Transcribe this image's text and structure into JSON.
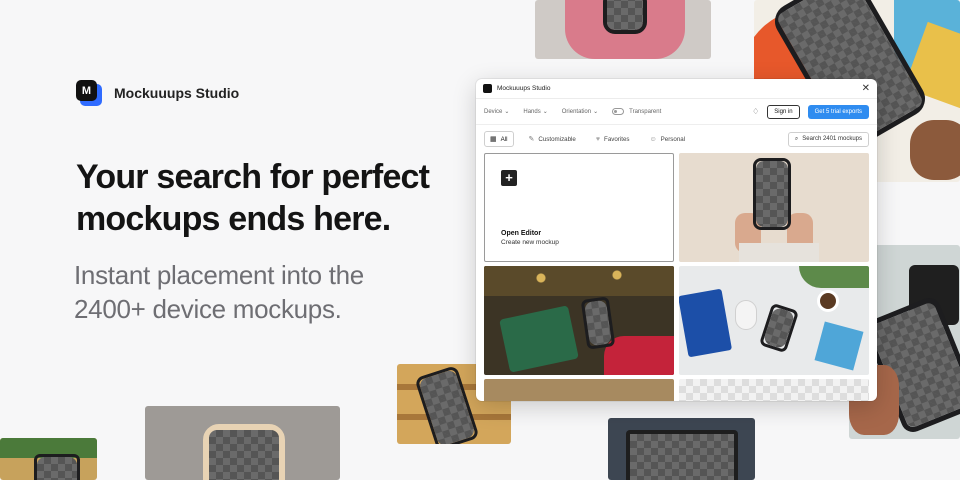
{
  "brand": {
    "name": "Mockuuups Studio",
    "logo_letter": "M"
  },
  "hero": {
    "headline": "Your search for perfect mockups ends here.",
    "subheadline": "Instant placement into the 2400+ device mockups."
  },
  "app": {
    "title": "Mockuuups Studio",
    "close_glyph": "✕",
    "toolbar": {
      "device": "Device",
      "hands": "Hands",
      "orientation": "Orientation",
      "transparent": "Transparent",
      "sign_in": "Sign in",
      "trial": "Get 5 trial exports"
    },
    "filters": {
      "all": "All",
      "customizable": "Customizable",
      "favorites": "Favorites",
      "personal": "Personal",
      "search_placeholder": "Search 2401 mockups"
    },
    "editor_card": {
      "plus": "+",
      "title": "Open Editor",
      "subtitle": "Create new mockup"
    }
  },
  "colors": {
    "accent": "#2f8cf0",
    "brand_blue": "#2f6bff"
  },
  "icons": {
    "chevron": "⌄",
    "bell": "🔔",
    "grid": "▦",
    "pen": "✎",
    "heart": "♥",
    "user": "👤",
    "search": "⌕"
  }
}
